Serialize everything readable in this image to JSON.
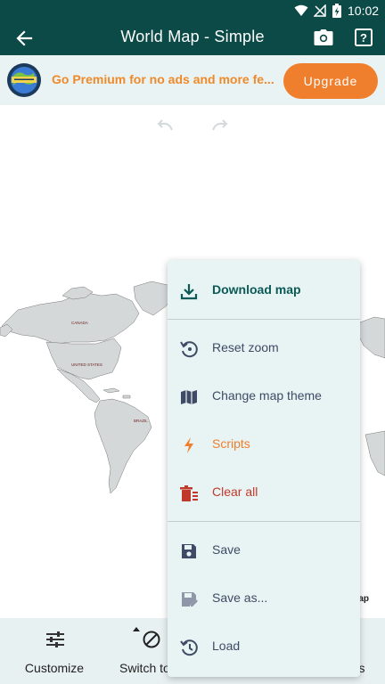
{
  "status_bar": {
    "time": "10:02"
  },
  "app_bar": {
    "title": "World Map - Simple"
  },
  "premium": {
    "text": "Go Premium for no ads and more fe...",
    "upgrade_label": "Upgrade"
  },
  "map": {
    "labels": [
      "CANADA",
      "UNITED STATES",
      "BRAZIL",
      "Map"
    ]
  },
  "menu": {
    "items": [
      {
        "label": "Download map",
        "icon": "download-icon",
        "color": "#0b5a57"
      },
      {
        "label": "Reset zoom",
        "icon": "reset-zoom-icon",
        "color": "#3f4b66"
      },
      {
        "label": "Change map theme",
        "icon": "map-icon",
        "color": "#3f4b66"
      },
      {
        "label": "Scripts",
        "icon": "bolt-icon",
        "color": "#ef7f2d"
      },
      {
        "label": "Clear all",
        "icon": "clear-all-icon",
        "color": "#c0392b"
      },
      {
        "label": "Save",
        "icon": "save-icon",
        "color": "#3f4b66"
      },
      {
        "label": "Save as...",
        "icon": "save-as-icon",
        "color": "#3f4b66"
      },
      {
        "label": "Load",
        "icon": "history-icon",
        "color": "#3f4b66"
      }
    ]
  },
  "bottom_bar": {
    "customize_label": "Customize",
    "switch_label": "Switch to",
    "right_label_partial": "s"
  },
  "colors": {
    "app_bar": "#0b4a47",
    "accent_orange": "#ef7f2d",
    "menu_bg": "#e8f3f3",
    "bottom_bar_bg": "#e8f1f1"
  }
}
